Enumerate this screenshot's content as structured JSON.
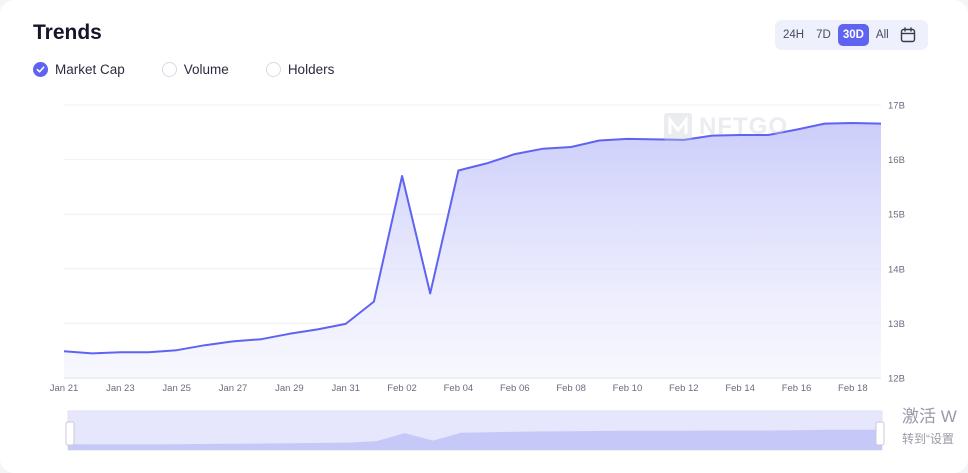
{
  "title": "Trends",
  "legend": [
    {
      "label": "Market Cap",
      "checked": true
    },
    {
      "label": "Volume",
      "checked": false
    },
    {
      "label": "Holders",
      "checked": false
    }
  ],
  "ranges": [
    "24H",
    "7D",
    "30D",
    "All"
  ],
  "active_range": "30D",
  "watermark": "NFTGO",
  "os_overlay": {
    "line1": "激活 W",
    "line2": "转到“设置"
  },
  "colors": {
    "accent": "#5f63f2",
    "fill": "#d9dbfb"
  },
  "chart_data": {
    "type": "area",
    "x": [
      "Jan 21",
      "Jan 22",
      "Jan 23",
      "Jan 24",
      "Jan 25",
      "Jan 26",
      "Jan 27",
      "Jan 28",
      "Jan 29",
      "Jan 30",
      "Jan 31",
      "Feb 01",
      "Feb 02",
      "Feb 03",
      "Feb 04",
      "Feb 05",
      "Feb 06",
      "Feb 07",
      "Feb 08",
      "Feb 09",
      "Feb 10",
      "Feb 11",
      "Feb 12",
      "Feb 13",
      "Feb 14",
      "Feb 15",
      "Feb 16",
      "Feb 17",
      "Feb 18",
      "Feb 19"
    ],
    "series": [
      {
        "values": [
          12.49,
          12.45,
          12.47,
          12.47,
          12.51,
          12.6,
          12.67,
          12.71,
          12.81,
          12.89,
          12.99,
          13.4,
          15.7,
          13.55,
          15.8,
          15.93,
          16.1,
          16.2,
          16.23,
          16.35,
          16.38,
          16.37,
          16.36,
          16.44,
          16.45,
          16.45,
          16.55,
          16.66,
          16.67,
          16.66
        ]
      }
    ],
    "x_ticks": [
      "Jan 21",
      "Jan 23",
      "Jan 25",
      "Jan 27",
      "Jan 29",
      "Jan 31",
      "Feb 02",
      "Feb 04",
      "Feb 06",
      "Feb 08",
      "Feb 10",
      "Feb 12",
      "Feb 14",
      "Feb 16",
      "Feb 18"
    ],
    "y_ticks": [
      "12B",
      "13B",
      "14B",
      "15B",
      "16B",
      "17B"
    ],
    "ylim": [
      12,
      17
    ],
    "y_axis_side": "right",
    "grid": true,
    "navigator": true
  }
}
